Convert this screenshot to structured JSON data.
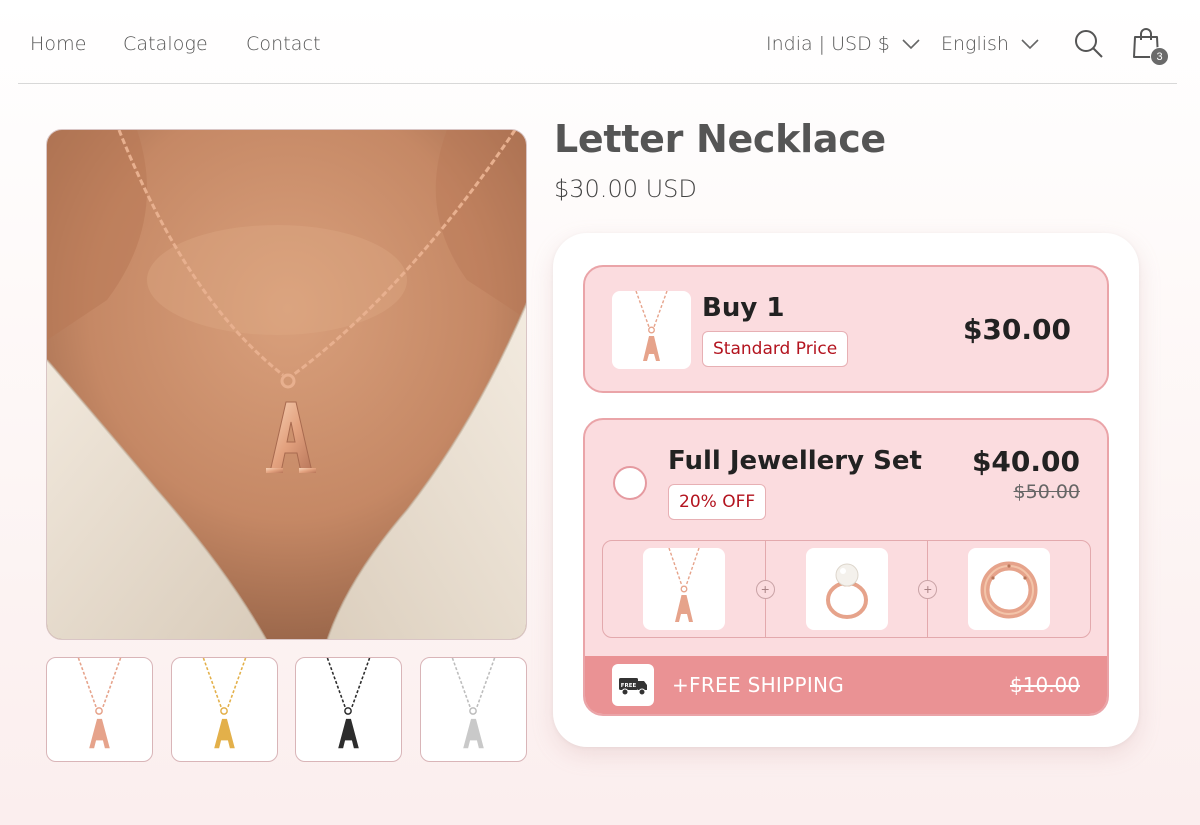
{
  "nav": {
    "links": [
      "Home",
      "Cataloge",
      "Contact"
    ],
    "region": "India | USD $",
    "language": "English",
    "cart_count": "3"
  },
  "product": {
    "title": "Letter Necklace",
    "price": "$30.00 USD",
    "thumbnails": [
      {
        "name": "rose-gold",
        "color": "#e6a38b"
      },
      {
        "name": "gold",
        "color": "#e3b04a"
      },
      {
        "name": "black",
        "color": "#2d2d2d"
      },
      {
        "name": "silver",
        "color": "#c9c9c9"
      }
    ]
  },
  "offers": {
    "buy1": {
      "name": "Buy 1",
      "tag": "Standard Price",
      "price": "$30.00"
    },
    "set": {
      "name": "Full Jewellery Set",
      "tag": "20% OFF",
      "price": "$40.00",
      "old_price": "$50.00",
      "items": [
        "letter-necklace",
        "pearl-ring",
        "gold-band-ring"
      ],
      "shipping_label": "+FREE SHIPPING",
      "shipping_old_price": "$10.00",
      "shipping_icon_text": "FREE"
    }
  },
  "colors": {
    "accent_pink": "#fbdcdf",
    "border_pink": "#eaa4a8",
    "shipping_bar": "#ea9294",
    "tag_text": "#b3141f"
  }
}
